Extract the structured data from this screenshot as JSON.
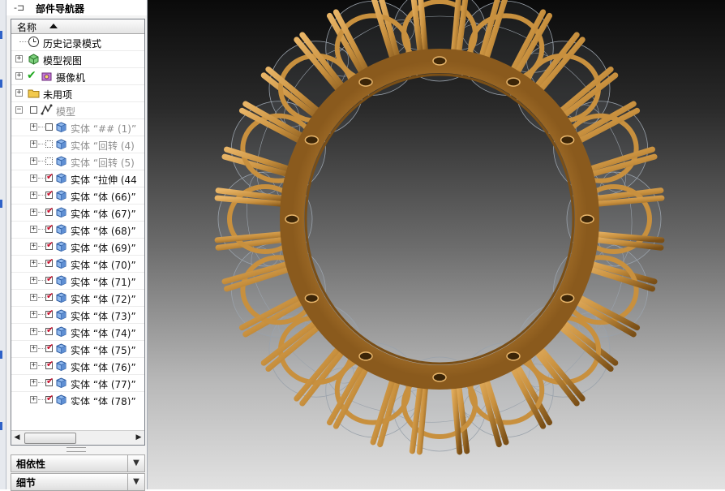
{
  "navigator": {
    "title": "部件导航器",
    "column_header": "名称",
    "tree": [
      {
        "label": "历史记录模式",
        "icon": "clock-icon",
        "style": "normal"
      },
      {
        "label": "模型视图",
        "icon": "model-views-icon",
        "style": "normal"
      },
      {
        "label": "摄像机",
        "icon": "camera-icon",
        "style": "normal"
      },
      {
        "label": "未用项",
        "icon": "folder-icon",
        "style": "normal"
      },
      {
        "label": "模型",
        "icon": "model-icon",
        "style": "grey"
      },
      {
        "label": "实体 “## (1)”",
        "state": "unchecked",
        "style": "grey"
      },
      {
        "label": "实体 “回转 (4)",
        "state": "dotted",
        "style": "grey"
      },
      {
        "label": "实体 “回转 (5)",
        "state": "dotted",
        "style": "grey"
      },
      {
        "label": "实体 “拉伸 (44",
        "state": "checked",
        "style": "body"
      },
      {
        "label": "实体 “体 (66)”",
        "state": "checked",
        "style": "body"
      },
      {
        "label": "实体 “体 (67)”",
        "state": "checked",
        "style": "body"
      },
      {
        "label": "实体 “体 (68)”",
        "state": "checked",
        "style": "body"
      },
      {
        "label": "实体 “体 (69)”",
        "state": "checked",
        "style": "body"
      },
      {
        "label": "实体 “体 (70)”",
        "state": "checked",
        "style": "body"
      },
      {
        "label": "实体 “体 (71)”",
        "state": "checked",
        "style": "body"
      },
      {
        "label": "实体 “体 (72)”",
        "state": "checked",
        "style": "body"
      },
      {
        "label": "实体 “体 (73)”",
        "state": "checked",
        "style": "body"
      },
      {
        "label": "实体 “体 (74)”",
        "state": "checked",
        "style": "body"
      },
      {
        "label": "实体 “体 (75)”",
        "state": "checked",
        "style": "body"
      },
      {
        "label": "实体 “体 (76)”",
        "state": "checked",
        "style": "body"
      },
      {
        "label": "实体 “体 (77)”",
        "state": "checked",
        "style": "body"
      },
      {
        "label": "实体 “体 (78)”",
        "state": "checked",
        "style": "body"
      }
    ]
  },
  "sections": {
    "dependencies": "相依性",
    "details": "细节"
  },
  "colors": {
    "gold": "#c8903e",
    "gold_dark": "#7a4f17",
    "wireframe": "#9aa2ab"
  }
}
